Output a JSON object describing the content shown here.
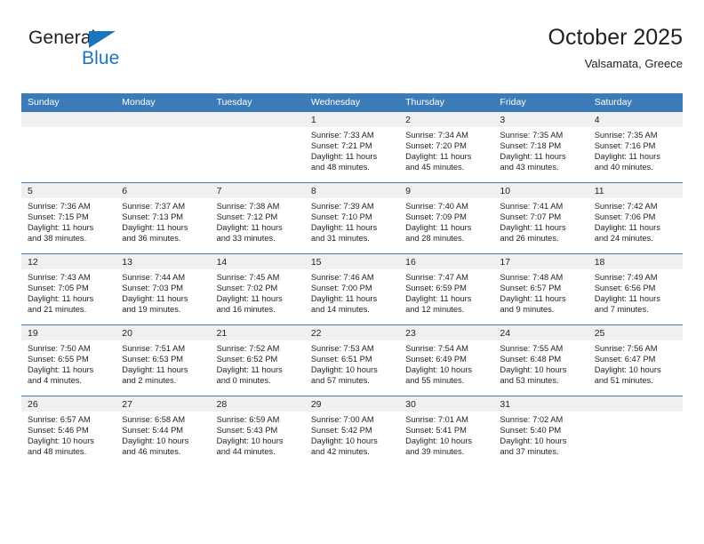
{
  "brand": {
    "name_part1": "General",
    "name_part2": "Blue",
    "flag_icon": "triangle-flag-icon",
    "color_primary": "#1b75bc"
  },
  "header": {
    "title": "October 2025",
    "subtitle": "Valsamata, Greece"
  },
  "theme": {
    "header_bg": "#3b7cb8",
    "daynum_bg": "#f0f0f0",
    "text": "#231f20"
  },
  "weekdays": [
    "Sunday",
    "Monday",
    "Tuesday",
    "Wednesday",
    "Thursday",
    "Friday",
    "Saturday"
  ],
  "weeks": [
    [
      {
        "day": "",
        "sunrise": "",
        "sunset": "",
        "daylight_l1": "",
        "daylight_l2": ""
      },
      {
        "day": "",
        "sunrise": "",
        "sunset": "",
        "daylight_l1": "",
        "daylight_l2": ""
      },
      {
        "day": "",
        "sunrise": "",
        "sunset": "",
        "daylight_l1": "",
        "daylight_l2": ""
      },
      {
        "day": "1",
        "sunrise": "Sunrise: 7:33 AM",
        "sunset": "Sunset: 7:21 PM",
        "daylight_l1": "Daylight: 11 hours",
        "daylight_l2": "and 48 minutes."
      },
      {
        "day": "2",
        "sunrise": "Sunrise: 7:34 AM",
        "sunset": "Sunset: 7:20 PM",
        "daylight_l1": "Daylight: 11 hours",
        "daylight_l2": "and 45 minutes."
      },
      {
        "day": "3",
        "sunrise": "Sunrise: 7:35 AM",
        "sunset": "Sunset: 7:18 PM",
        "daylight_l1": "Daylight: 11 hours",
        "daylight_l2": "and 43 minutes."
      },
      {
        "day": "4",
        "sunrise": "Sunrise: 7:35 AM",
        "sunset": "Sunset: 7:16 PM",
        "daylight_l1": "Daylight: 11 hours",
        "daylight_l2": "and 40 minutes."
      }
    ],
    [
      {
        "day": "5",
        "sunrise": "Sunrise: 7:36 AM",
        "sunset": "Sunset: 7:15 PM",
        "daylight_l1": "Daylight: 11 hours",
        "daylight_l2": "and 38 minutes."
      },
      {
        "day": "6",
        "sunrise": "Sunrise: 7:37 AM",
        "sunset": "Sunset: 7:13 PM",
        "daylight_l1": "Daylight: 11 hours",
        "daylight_l2": "and 36 minutes."
      },
      {
        "day": "7",
        "sunrise": "Sunrise: 7:38 AM",
        "sunset": "Sunset: 7:12 PM",
        "daylight_l1": "Daylight: 11 hours",
        "daylight_l2": "and 33 minutes."
      },
      {
        "day": "8",
        "sunrise": "Sunrise: 7:39 AM",
        "sunset": "Sunset: 7:10 PM",
        "daylight_l1": "Daylight: 11 hours",
        "daylight_l2": "and 31 minutes."
      },
      {
        "day": "9",
        "sunrise": "Sunrise: 7:40 AM",
        "sunset": "Sunset: 7:09 PM",
        "daylight_l1": "Daylight: 11 hours",
        "daylight_l2": "and 28 minutes."
      },
      {
        "day": "10",
        "sunrise": "Sunrise: 7:41 AM",
        "sunset": "Sunset: 7:07 PM",
        "daylight_l1": "Daylight: 11 hours",
        "daylight_l2": "and 26 minutes."
      },
      {
        "day": "11",
        "sunrise": "Sunrise: 7:42 AM",
        "sunset": "Sunset: 7:06 PM",
        "daylight_l1": "Daylight: 11 hours",
        "daylight_l2": "and 24 minutes."
      }
    ],
    [
      {
        "day": "12",
        "sunrise": "Sunrise: 7:43 AM",
        "sunset": "Sunset: 7:05 PM",
        "daylight_l1": "Daylight: 11 hours",
        "daylight_l2": "and 21 minutes."
      },
      {
        "day": "13",
        "sunrise": "Sunrise: 7:44 AM",
        "sunset": "Sunset: 7:03 PM",
        "daylight_l1": "Daylight: 11 hours",
        "daylight_l2": "and 19 minutes."
      },
      {
        "day": "14",
        "sunrise": "Sunrise: 7:45 AM",
        "sunset": "Sunset: 7:02 PM",
        "daylight_l1": "Daylight: 11 hours",
        "daylight_l2": "and 16 minutes."
      },
      {
        "day": "15",
        "sunrise": "Sunrise: 7:46 AM",
        "sunset": "Sunset: 7:00 PM",
        "daylight_l1": "Daylight: 11 hours",
        "daylight_l2": "and 14 minutes."
      },
      {
        "day": "16",
        "sunrise": "Sunrise: 7:47 AM",
        "sunset": "Sunset: 6:59 PM",
        "daylight_l1": "Daylight: 11 hours",
        "daylight_l2": "and 12 minutes."
      },
      {
        "day": "17",
        "sunrise": "Sunrise: 7:48 AM",
        "sunset": "Sunset: 6:57 PM",
        "daylight_l1": "Daylight: 11 hours",
        "daylight_l2": "and 9 minutes."
      },
      {
        "day": "18",
        "sunrise": "Sunrise: 7:49 AM",
        "sunset": "Sunset: 6:56 PM",
        "daylight_l1": "Daylight: 11 hours",
        "daylight_l2": "and 7 minutes."
      }
    ],
    [
      {
        "day": "19",
        "sunrise": "Sunrise: 7:50 AM",
        "sunset": "Sunset: 6:55 PM",
        "daylight_l1": "Daylight: 11 hours",
        "daylight_l2": "and 4 minutes."
      },
      {
        "day": "20",
        "sunrise": "Sunrise: 7:51 AM",
        "sunset": "Sunset: 6:53 PM",
        "daylight_l1": "Daylight: 11 hours",
        "daylight_l2": "and 2 minutes."
      },
      {
        "day": "21",
        "sunrise": "Sunrise: 7:52 AM",
        "sunset": "Sunset: 6:52 PM",
        "daylight_l1": "Daylight: 11 hours",
        "daylight_l2": "and 0 minutes."
      },
      {
        "day": "22",
        "sunrise": "Sunrise: 7:53 AM",
        "sunset": "Sunset: 6:51 PM",
        "daylight_l1": "Daylight: 10 hours",
        "daylight_l2": "and 57 minutes."
      },
      {
        "day": "23",
        "sunrise": "Sunrise: 7:54 AM",
        "sunset": "Sunset: 6:49 PM",
        "daylight_l1": "Daylight: 10 hours",
        "daylight_l2": "and 55 minutes."
      },
      {
        "day": "24",
        "sunrise": "Sunrise: 7:55 AM",
        "sunset": "Sunset: 6:48 PM",
        "daylight_l1": "Daylight: 10 hours",
        "daylight_l2": "and 53 minutes."
      },
      {
        "day": "25",
        "sunrise": "Sunrise: 7:56 AM",
        "sunset": "Sunset: 6:47 PM",
        "daylight_l1": "Daylight: 10 hours",
        "daylight_l2": "and 51 minutes."
      }
    ],
    [
      {
        "day": "26",
        "sunrise": "Sunrise: 6:57 AM",
        "sunset": "Sunset: 5:46 PM",
        "daylight_l1": "Daylight: 10 hours",
        "daylight_l2": "and 48 minutes."
      },
      {
        "day": "27",
        "sunrise": "Sunrise: 6:58 AM",
        "sunset": "Sunset: 5:44 PM",
        "daylight_l1": "Daylight: 10 hours",
        "daylight_l2": "and 46 minutes."
      },
      {
        "day": "28",
        "sunrise": "Sunrise: 6:59 AM",
        "sunset": "Sunset: 5:43 PM",
        "daylight_l1": "Daylight: 10 hours",
        "daylight_l2": "and 44 minutes."
      },
      {
        "day": "29",
        "sunrise": "Sunrise: 7:00 AM",
        "sunset": "Sunset: 5:42 PM",
        "daylight_l1": "Daylight: 10 hours",
        "daylight_l2": "and 42 minutes."
      },
      {
        "day": "30",
        "sunrise": "Sunrise: 7:01 AM",
        "sunset": "Sunset: 5:41 PM",
        "daylight_l1": "Daylight: 10 hours",
        "daylight_l2": "and 39 minutes."
      },
      {
        "day": "31",
        "sunrise": "Sunrise: 7:02 AM",
        "sunset": "Sunset: 5:40 PM",
        "daylight_l1": "Daylight: 10 hours",
        "daylight_l2": "and 37 minutes."
      },
      {
        "day": "",
        "sunrise": "",
        "sunset": "",
        "daylight_l1": "",
        "daylight_l2": ""
      }
    ]
  ]
}
